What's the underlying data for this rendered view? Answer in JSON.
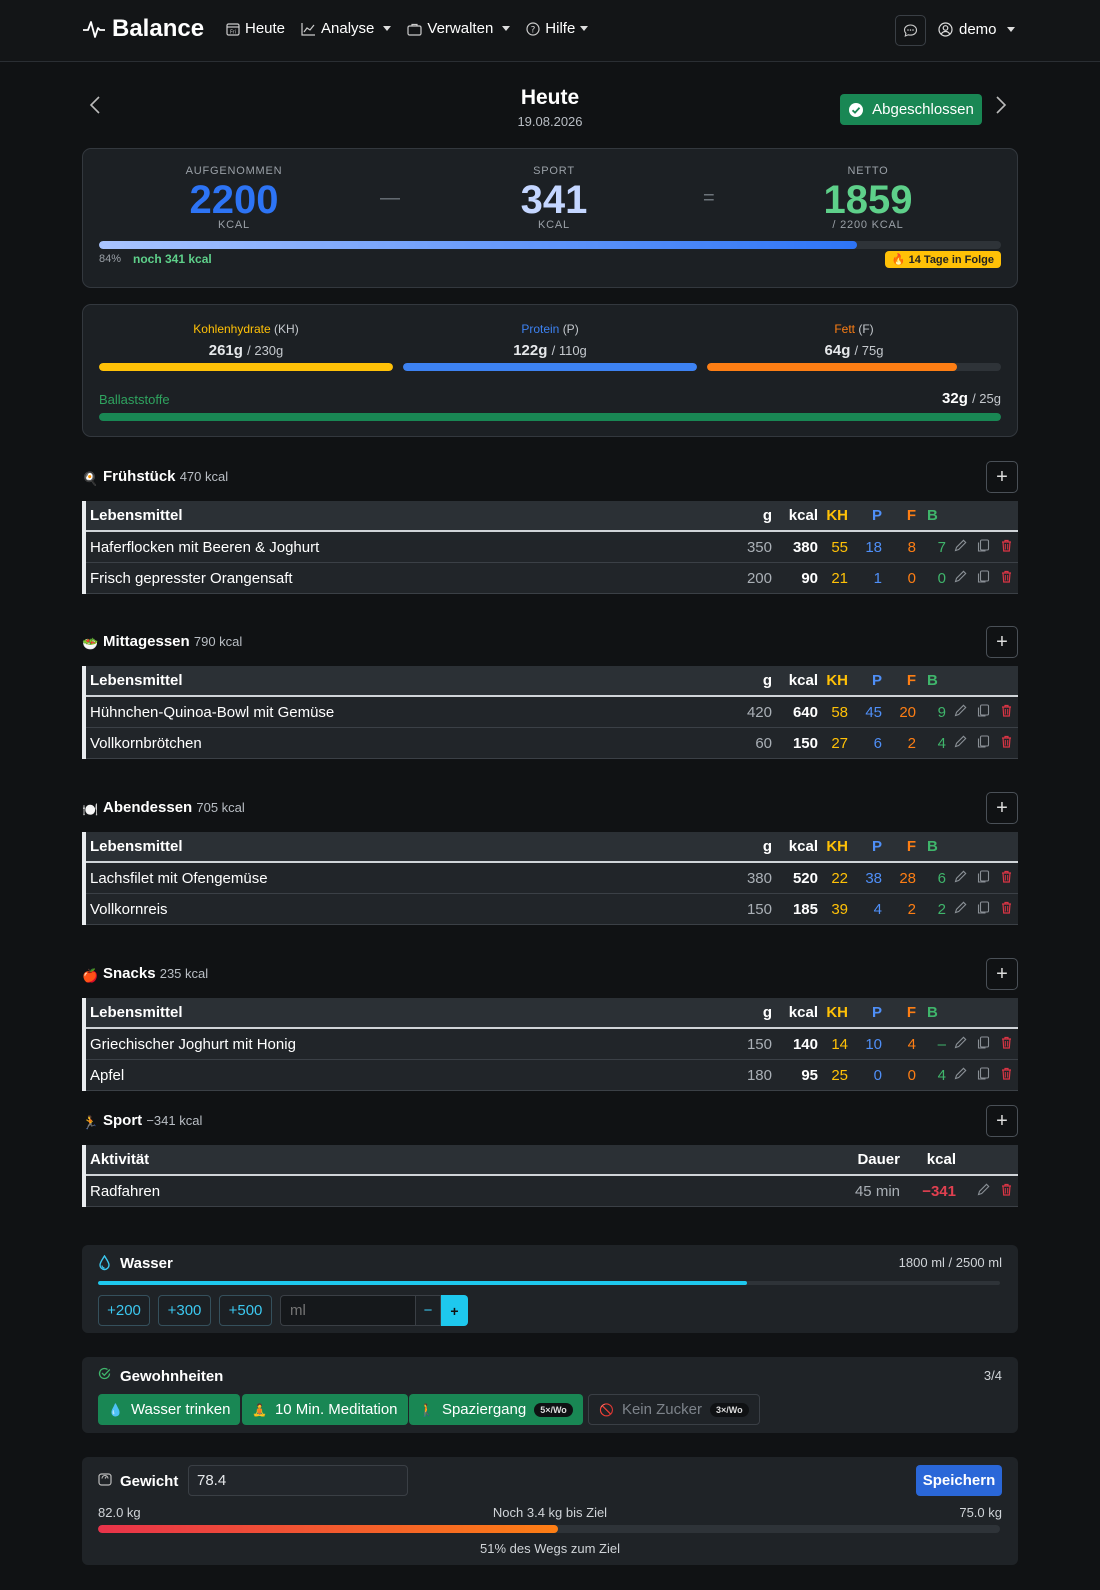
{
  "nav": {
    "brand": "Balance",
    "links": [
      {
        "label": "Heute",
        "icon": "calendar-icon",
        "dropdown": false
      },
      {
        "label": "Analyse",
        "icon": "chart-line-icon",
        "dropdown": true
      },
      {
        "label": "Verwalten",
        "icon": "briefcase-icon",
        "dropdown": true
      },
      {
        "label": "Hilfe",
        "icon": "question-circle-icon",
        "dropdown": true
      }
    ],
    "user": "demo"
  },
  "day": {
    "title": "Heute",
    "date": "19.08.2026",
    "status": "Abgeschlossen"
  },
  "summary": {
    "intake": {
      "label": "AUFGENOMMEN",
      "value": "2200",
      "unit": "KCAL"
    },
    "sport": {
      "label": "SPORT",
      "value": "341",
      "unit": "KCAL"
    },
    "net": {
      "label": "NETTO",
      "value": "1859",
      "unit": "/ 2200 KCAL"
    },
    "minus": "—",
    "equals": "=",
    "progress": 0.84,
    "percent": "84%",
    "remaining": "noch 341 kcal",
    "streak": "14 Tage in Folge",
    "colors": {
      "intake": "#2d74f5",
      "sport": "#c4d6ff",
      "net": "#5ed08a"
    }
  },
  "macros": {
    "carbs": {
      "name": "Kohlenhydrate",
      "abbr": "(KH)",
      "value": "261g",
      "goal": "/ 230g",
      "progress": 1.0,
      "color": "#ffc107"
    },
    "protein": {
      "name": "Protein",
      "abbr": "(P)",
      "value": "122g",
      "goal": "/ 110g",
      "progress": 1.0,
      "color": "#3d82f2"
    },
    "fat": {
      "name": "Fett",
      "abbr": "(F)",
      "value": "64g",
      "goal": "/ 75g",
      "progress": 0.85,
      "color": "#fd7e14"
    },
    "fiber": {
      "name": "Ballaststoffe",
      "value": "32g",
      "goal": "/ 25g",
      "progress": 1.0,
      "color": "#198754"
    }
  },
  "table_headers": {
    "food": "Lebensmittel",
    "g": "g",
    "kcal": "kcal",
    "kh": "KH",
    "p": "P",
    "f": "F",
    "b": "B"
  },
  "meals": [
    {
      "name": "Frühstück",
      "kcal": "470 kcal",
      "icon": "frying-pan-icon",
      "rows": [
        {
          "name": "Haferflocken mit Beeren & Joghurt",
          "g": "350",
          "kcal": "380",
          "kh": "55",
          "p": "18",
          "f": "8",
          "b": "7"
        },
        {
          "name": "Frisch gepresster Orangensaft",
          "g": "200",
          "kcal": "90",
          "kh": "21",
          "p": "1",
          "f": "0",
          "b": "0"
        }
      ]
    },
    {
      "name": "Mittagessen",
      "kcal": "790 kcal",
      "icon": "salad-bowl-icon",
      "rows": [
        {
          "name": "Hühnchen-Quinoa-Bowl mit Gemüse",
          "g": "420",
          "kcal": "640",
          "kh": "58",
          "p": "45",
          "f": "20",
          "b": "9"
        },
        {
          "name": "Vollkornbrötchen",
          "g": "60",
          "kcal": "150",
          "kh": "27",
          "p": "6",
          "f": "2",
          "b": "4"
        }
      ]
    },
    {
      "name": "Abendessen",
      "kcal": "705 kcal",
      "icon": "plate-cutlery-icon",
      "rows": [
        {
          "name": "Lachsfilet mit Ofengemüse",
          "g": "380",
          "kcal": "520",
          "kh": "22",
          "p": "38",
          "f": "28",
          "b": "6"
        },
        {
          "name": "Vollkornreis",
          "g": "150",
          "kcal": "185",
          "kh": "39",
          "p": "4",
          "f": "2",
          "b": "2"
        }
      ]
    },
    {
      "name": "Snacks",
      "kcal": "235 kcal",
      "icon": "apple-icon",
      "rows": [
        {
          "name": "Griechischer Joghurt mit Honig",
          "g": "150",
          "kcal": "140",
          "kh": "14",
          "p": "10",
          "f": "4",
          "b": "–"
        },
        {
          "name": "Apfel",
          "g": "180",
          "kcal": "95",
          "kh": "25",
          "p": "0",
          "f": "0",
          "b": "4"
        }
      ]
    }
  ],
  "sport": {
    "name": "Sport",
    "kcal": "−341 kcal",
    "icon": "runner-icon",
    "headers": {
      "activity": "Aktivität",
      "duration": "Dauer",
      "kcal": "kcal"
    },
    "rows": [
      {
        "name": "Radfahren",
        "duration": "45 min",
        "kcal": "−341"
      }
    ]
  },
  "water": {
    "title": "Wasser",
    "amount": "1800 ml / 2500 ml",
    "progress": 0.72,
    "quick": [
      "+200",
      "+300",
      "+500"
    ],
    "placeholder": "ml",
    "minus": "−",
    "plus": "+"
  },
  "habits": {
    "title": "Gewohnheiten",
    "count": "3/4",
    "items": [
      {
        "label": "Wasser trinken",
        "done": true,
        "icon": "droplet-icon",
        "badge": ""
      },
      {
        "label": "10 Min. Meditation",
        "done": true,
        "icon": "meditation-icon",
        "badge": ""
      },
      {
        "label": "Spaziergang",
        "done": true,
        "icon": "walking-icon",
        "badge": "5×/Wo"
      },
      {
        "label": "Kein Zucker",
        "done": false,
        "icon": "no-entry-icon",
        "badge": "3×/Wo"
      }
    ]
  },
  "weight": {
    "title": "Gewicht",
    "value": "78.4",
    "save": "Speichern",
    "start": "82.0 kg",
    "goal": "75.0 kg",
    "remaining": "Noch 3.4 kg bis Ziel",
    "progress": 0.51,
    "progress_text": "51% des Wegs zum Ziel"
  }
}
